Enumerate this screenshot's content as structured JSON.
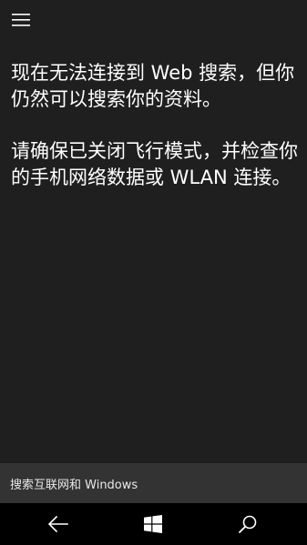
{
  "header": {
    "menu_icon": "hamburger-menu-icon"
  },
  "message": {
    "line1": "现在无法连接到 Web 搜索，但你仍然可以搜索你的资料。",
    "line2": "请确保已关闭飞行模式，并检查你的手机网络数据或 WLAN 连接。"
  },
  "search_bar": {
    "label": "搜索互联网和 Windows"
  },
  "navbar": {
    "back_icon": "back-arrow-icon",
    "start_icon": "windows-logo-icon",
    "search_icon": "search-icon"
  },
  "colors": {
    "background": "#1f1f1f",
    "search_bar": "#333333",
    "navbar": "#000000",
    "text": "#ffffff"
  }
}
